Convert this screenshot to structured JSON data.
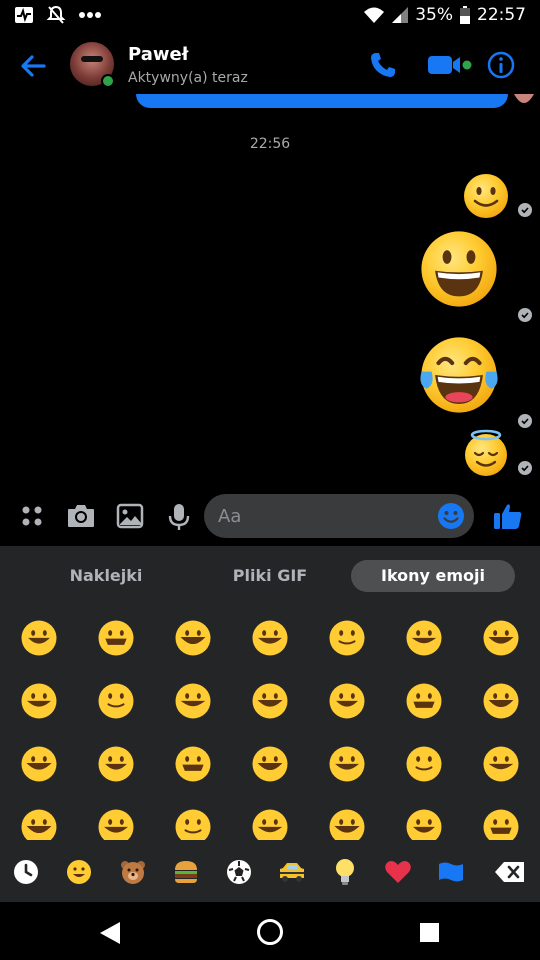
{
  "status_bar": {
    "battery_percent": "35%",
    "time": "22:57"
  },
  "header": {
    "contact_name": "Paweł",
    "presence": "Aktywny(a) teraz"
  },
  "conversation": {
    "timestamp": "22:56",
    "sent_emojis": [
      {
        "emoji": "slightly-smiling-face"
      },
      {
        "emoji": "grinning-face"
      },
      {
        "emoji": "face-with-tears-of-joy"
      },
      {
        "emoji": "smiling-face-with-halo"
      }
    ]
  },
  "composer": {
    "placeholder": "Aa"
  },
  "emoji_panel": {
    "tabs": [
      "Naklejki",
      "Pliki GIF",
      "Ikony emoji"
    ],
    "active_tab": "Ikony emoji",
    "categories": [
      "recent-icon",
      "smileys-icon",
      "animals-icon",
      "food-icon",
      "activity-icon",
      "travel-icon",
      "objects-icon",
      "symbols-icon",
      "flags-icon",
      "backspace-icon"
    ],
    "selected_category": "smileys-icon"
  },
  "colors": {
    "accent": "#1877f2",
    "online": "#31a24c",
    "panel": "#242526"
  }
}
